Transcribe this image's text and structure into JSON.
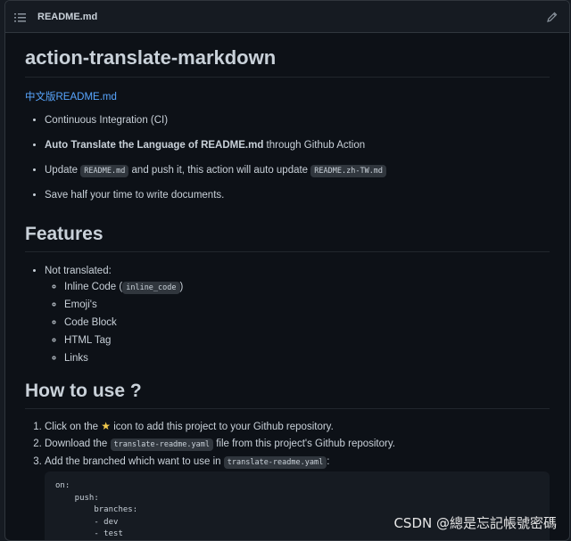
{
  "header": {
    "file_title": "README.md"
  },
  "readme": {
    "title": "action-translate-markdown",
    "cn_link": "中文版README.md",
    "bullets": {
      "b1": "Continuous Integration (CI)",
      "b2_bold": "Auto Translate the Language of README.md",
      "b2_rest": " through Github Action",
      "b3_pre": "Update ",
      "b3_code1": "README.md",
      "b3_mid": " and push it, this action will auto update ",
      "b3_code2": "README.zh-TW.md",
      "b4": "Save half your time to write documents."
    },
    "features": {
      "heading": "Features",
      "not_translated": "Not translated:",
      "inline_code_pre": "Inline Code (",
      "inline_code_code": "inline_code",
      "inline_code_post": ")",
      "emojis": "Emoji's",
      "code_block": "Code Block",
      "html_tag": "HTML Tag",
      "links": "Links"
    },
    "how_to_use": {
      "heading": "How to use ?",
      "step1_pre": "Click on the ",
      "step1_post": " icon to add this project to your Github repository.",
      "step2_pre": "Download the ",
      "step2_code": "translate-readme.yaml",
      "step2_post": " file from this project's Github repository.",
      "step3_pre": "Add the branched which want to use in ",
      "step3_code": "translate-readme.yaml",
      "step3_post": ":",
      "code_block": "on:\n    push:\n        branches:\n        - dev\n        - test\n        - main"
    }
  },
  "watermark": "CSDN @總是忘記帳號密碼",
  "icons": {
    "toc": "list-icon",
    "edit": "pencil-icon",
    "star": "star-emoji-icon"
  },
  "colors": {
    "link": "#58a6ff",
    "background": "#0d1117",
    "header": "#161b22"
  }
}
